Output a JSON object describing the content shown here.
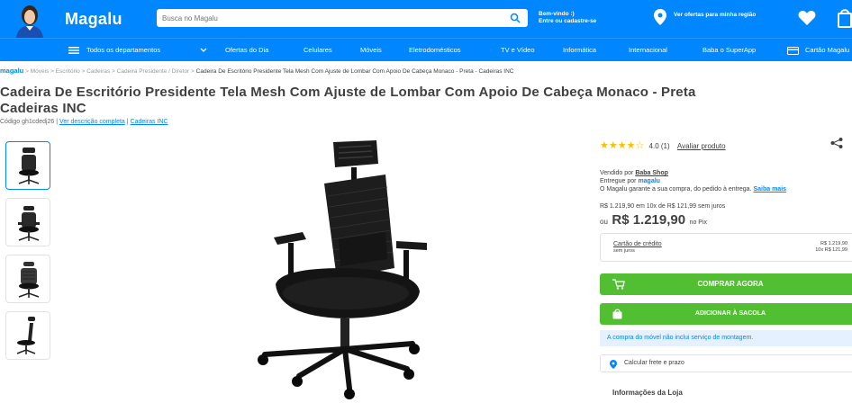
{
  "header": {
    "logo": "Magalu",
    "search_placeholder": "Busca no Magalu",
    "welcome_line1": "Bem-vindo :)",
    "welcome_line2": "Entre ou cadastre-se",
    "offers_text": "Ver ofertas para minha região",
    "brand_color": "#0086ff"
  },
  "nav": {
    "items": [
      "Todos os departamentos",
      "Ofertas do Dia",
      "Celulares",
      "Móveis",
      "Eletrodomésticos",
      "TV e Vídeo",
      "Informática",
      "Internacional",
      "Baba o SuperApp",
      "Cartão Magalu"
    ]
  },
  "breadcrumb": {
    "home": "magalu",
    "items": [
      "Móveis",
      "Escritório",
      "Cadeiras",
      "Cadeira Presidente / Diretor"
    ],
    "current": "Cadeira De Escritório Presidente Tela Mesh Com Ajuste de Lombar Com Apoio De Cabeça Monaco - Preta - Cadeiras INC"
  },
  "product": {
    "title_line1": "Cadeira De Escritório Presidente Tela Mesh Com Ajuste de Lombar Com Apoio De Cabeça Monaco - Preta",
    "title_line2": "Cadeiras INC",
    "code": "Código gh1cdedj26",
    "full_description_link": "Ver descrição completa",
    "brand_link": "Cadeiras INC"
  },
  "rating": {
    "stars": "★★★★☆",
    "value": "4.0 (1)",
    "rate_link": "Avaliar produto",
    "score": 4.0
  },
  "seller": {
    "sold_by_label": "Vendido por",
    "sold_by": "Baba Shop",
    "delivered_by_label": "Entregue por",
    "delivered_by": "magalu",
    "guarantee": "O Magalu garante a sua compra, do pedido à entrega.",
    "know_more": "Saiba mais"
  },
  "price": {
    "installments": "R$ 1.219,90 em 10x de R$ 121,99 sem juros",
    "or": "ou",
    "pix_price": "R$ 1.219,90",
    "pix_suffix": "no Pix"
  },
  "payment": {
    "card_title": "Cartão de crédito",
    "card_sub": "sem juros",
    "card_right_line1": "R$ 1.219,90",
    "card_right_line2": "10x R$ 121,99"
  },
  "actions": {
    "buy_now": "COMPRAR AGORA",
    "add_to_bag": "ADICIONAR À SACOLA",
    "button_color": "#52be32"
  },
  "notice": "A compra do móvel não inclui serviço de montagem.",
  "freight": "Calcular frete e prazo",
  "store_info": "Informações da Loja"
}
